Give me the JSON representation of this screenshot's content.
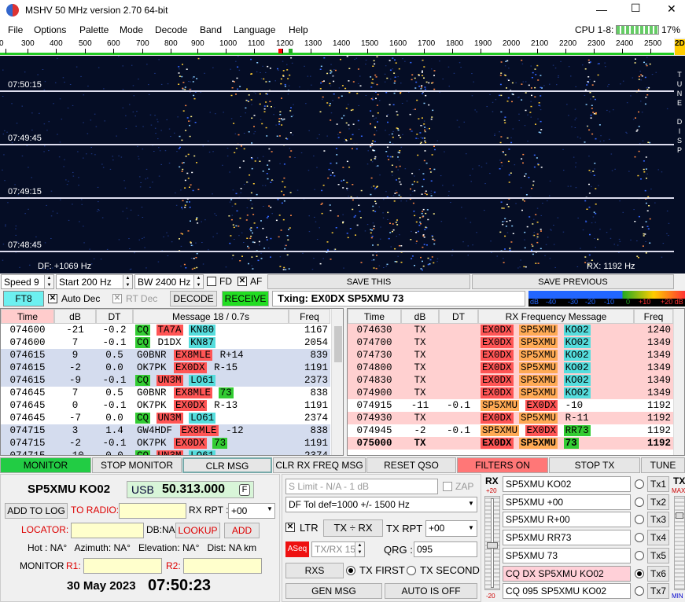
{
  "window": {
    "title": "MSHV 50 MHz version 2.70 64-bit",
    "min": "—",
    "max": "☐",
    "close": "✕"
  },
  "menu": [
    "File",
    "Options",
    "Palette",
    "Mode",
    "Decode",
    "Band",
    "Language",
    "Help"
  ],
  "cpu": {
    "label": "CPU 1-8:",
    "value": "17%"
  },
  "ruler": {
    "ticks": [
      "0",
      "300",
      "400",
      "500",
      "600",
      "700",
      "800",
      "900",
      "1000",
      "1100",
      "1200",
      "1300",
      "1400",
      "1500",
      "1600",
      "1700",
      "1800",
      "1900",
      "2000",
      "2100",
      "2200",
      "2300",
      "2400",
      "2500"
    ],
    "side": "2D"
  },
  "waterfall": {
    "times": [
      "07:50:15",
      "07:49:45",
      "07:49:15",
      "07:48:45"
    ],
    "df": "DF: +1069 Hz",
    "rx": "RX: 1192 Hz",
    "side_letters": [
      "T",
      "U",
      "N",
      "E",
      "",
      "D",
      "I",
      "S",
      "P"
    ]
  },
  "controls": {
    "speed": "Speed 9",
    "start": "Start 200 Hz",
    "bw": "BW 2400 Hz",
    "fd": "FD",
    "af": "AF",
    "save_this": "SAVE THIS",
    "save_previous": "SAVE PREVIOUS"
  },
  "mode_bar": {
    "mode": "FT8",
    "auto_dec": "Auto Dec",
    "rt_dec": "RT Dec",
    "decode": "DECODE",
    "receive": "RECEIVE",
    "txing": "Txing: EX0DX SP5XMU 73",
    "meter_labels": [
      "dB",
      "-40",
      "-30",
      "-20",
      "-10",
      "0",
      "+10",
      "+20 dB"
    ]
  },
  "left_table": {
    "headers": [
      "Time",
      "dB",
      "DT",
      "Message 18 / 0.7s",
      "Freq"
    ],
    "rows": [
      {
        "t": "074600",
        "db": "-21",
        "dt": "-0.2",
        "msg": [
          [
            "CQ",
            "g"
          ],
          [
            "TA7A",
            "r"
          ],
          [
            "KN80",
            "c"
          ]
        ],
        "f": "1167",
        "bg": "#ffffff"
      },
      {
        "t": "074600",
        "db": "7",
        "dt": "-0.1",
        "msg": [
          [
            "CQ",
            "g"
          ],
          [
            "D1DX",
            ""
          ],
          [
            "KN87",
            "c"
          ]
        ],
        "f": "2054",
        "bg": "#ffffff"
      },
      {
        "t": "074615",
        "db": "9",
        "dt": "0.5",
        "msg": [
          [
            "G0BNR",
            ""
          ],
          [
            "EX8MLE",
            "r"
          ],
          [
            "R+14",
            ""
          ]
        ],
        "f": "839",
        "bg": "#d4dcee"
      },
      {
        "t": "074615",
        "db": "-2",
        "dt": "0.0",
        "msg": [
          [
            "OK7PK",
            ""
          ],
          [
            "EX0DX",
            "r"
          ],
          [
            "R-15",
            ""
          ]
        ],
        "f": "1191",
        "bg": "#d4dcee"
      },
      {
        "t": "074615",
        "db": "-9",
        "dt": "-0.1",
        "msg": [
          [
            "CQ",
            "g"
          ],
          [
            "UN3M",
            "r"
          ],
          [
            "LO61",
            "c"
          ]
        ],
        "f": "2373",
        "bg": "#d4dcee"
      },
      {
        "t": "074645",
        "db": "7",
        "dt": "0.5",
        "msg": [
          [
            "G0BNR",
            ""
          ],
          [
            "EX8MLE",
            "r"
          ],
          [
            "73",
            "g"
          ]
        ],
        "f": "838",
        "bg": "#ffffff"
      },
      {
        "t": "074645",
        "db": "0",
        "dt": "-0.1",
        "msg": [
          [
            "OK7PK",
            ""
          ],
          [
            "EX0DX",
            "r"
          ],
          [
            "R-13",
            ""
          ]
        ],
        "f": "1191",
        "bg": "#ffffff"
      },
      {
        "t": "074645",
        "db": "-7",
        "dt": "0.0",
        "msg": [
          [
            "CQ",
            "g"
          ],
          [
            "UN3M",
            "r"
          ],
          [
            "LO61",
            "c"
          ]
        ],
        "f": "2374",
        "bg": "#ffffff"
      },
      {
        "t": "074715",
        "db": "3",
        "dt": "1.4",
        "msg": [
          [
            "GW4HDF",
            ""
          ],
          [
            "EX8MLE",
            "r"
          ],
          [
            "-12",
            ""
          ]
        ],
        "f": "838",
        "bg": "#d4dcee"
      },
      {
        "t": "074715",
        "db": "-2",
        "dt": "-0.1",
        "msg": [
          [
            "OK7PK",
            ""
          ],
          [
            "EX0DX",
            "r"
          ],
          [
            "73",
            "g"
          ]
        ],
        "f": "1191",
        "bg": "#d4dcee"
      },
      {
        "t": "074715",
        "db": "-10",
        "dt": "0.0",
        "msg": [
          [
            "CQ",
            "g"
          ],
          [
            "UN3M",
            "r"
          ],
          [
            "LO61",
            "c"
          ]
        ],
        "f": "2374",
        "bg": "#d4dcee"
      }
    ]
  },
  "right_table": {
    "headers": [
      "Time",
      "dB",
      "DT",
      "RX Frequency Message",
      "Freq"
    ],
    "rows": [
      {
        "t": "074630",
        "db": "TX",
        "dt": "",
        "msg": [
          [
            "EX0DX",
            "r"
          ],
          [
            "SP5XMU",
            "o"
          ],
          [
            "KO02",
            "c"
          ]
        ],
        "f": "1240",
        "bg": "#ffd0d0",
        "b": false
      },
      {
        "t": "074700",
        "db": "TX",
        "dt": "",
        "msg": [
          [
            "EX0DX",
            "r"
          ],
          [
            "SP5XMU",
            "o"
          ],
          [
            "KO02",
            "c"
          ]
        ],
        "f": "1349",
        "bg": "#ffd0d0",
        "b": false
      },
      {
        "t": "074730",
        "db": "TX",
        "dt": "",
        "msg": [
          [
            "EX0DX",
            "r"
          ],
          [
            "SP5XMU",
            "o"
          ],
          [
            "KO02",
            "c"
          ]
        ],
        "f": "1349",
        "bg": "#ffd0d0",
        "b": false
      },
      {
        "t": "074800",
        "db": "TX",
        "dt": "",
        "msg": [
          [
            "EX0DX",
            "r"
          ],
          [
            "SP5XMU",
            "o"
          ],
          [
            "KO02",
            "c"
          ]
        ],
        "f": "1349",
        "bg": "#ffd0d0",
        "b": false
      },
      {
        "t": "074830",
        "db": "TX",
        "dt": "",
        "msg": [
          [
            "EX0DX",
            "r"
          ],
          [
            "SP5XMU",
            "o"
          ],
          [
            "KO02",
            "c"
          ]
        ],
        "f": "1349",
        "bg": "#ffd0d0",
        "b": false
      },
      {
        "t": "074900",
        "db": "TX",
        "dt": "",
        "msg": [
          [
            "EX0DX",
            "r"
          ],
          [
            "SP5XMU",
            "o"
          ],
          [
            "KO02",
            "c"
          ]
        ],
        "f": "1349",
        "bg": "#ffd0d0",
        "b": false
      },
      {
        "t": "074915",
        "db": "-11",
        "dt": "-0.1",
        "msg": [
          [
            "SP5XMU",
            "o"
          ],
          [
            "EX0DX",
            "r"
          ],
          [
            "-10",
            ""
          ]
        ],
        "f": "1192",
        "bg": "#ffffff",
        "b": false
      },
      {
        "t": "074930",
        "db": "TX",
        "dt": "",
        "msg": [
          [
            "EX0DX",
            "r"
          ],
          [
            "SP5XMU",
            "o"
          ],
          [
            "R-11",
            ""
          ]
        ],
        "f": "1192",
        "bg": "#ffd0d0",
        "b": false
      },
      {
        "t": "074945",
        "db": "-2",
        "dt": "-0.1",
        "msg": [
          [
            "SP5XMU",
            "o"
          ],
          [
            "EX0DX",
            "r"
          ],
          [
            "RR73",
            "g"
          ]
        ],
        "f": "1192",
        "bg": "#ffffff",
        "b": false
      },
      {
        "t": "075000",
        "db": "TX",
        "dt": "",
        "msg": [
          [
            "EX0DX",
            "r"
          ],
          [
            "SP5XMU",
            "o"
          ],
          [
            "73",
            "g"
          ]
        ],
        "f": "1192",
        "bg": "#ffd0d0",
        "b": true
      }
    ]
  },
  "buttons_row": [
    "MONITOR",
    "STOP MONITOR",
    "CLR MSG",
    "CLR RX FREQ MSG",
    "RESET QSO",
    "FILTERS ON",
    "STOP TX",
    "TUNE"
  ],
  "station": {
    "call": "SP5XMU KO02",
    "mode": "USB",
    "freq": "50.313.000",
    "f_btn": "F",
    "add_log": "ADD TO LOG",
    "to_radio": "TO RADIO:",
    "rx_rpt_label": "RX RPT :",
    "rx_rpt": "+00",
    "locator": "LOCATOR:",
    "dbna": "DB:NA",
    "lookup": "LOOKUP",
    "add": "ADD",
    "info": "Hot : NA°   Azimuth: NA°   Elevation: NA°   Dist: NA km",
    "monitor": "MONITOR",
    "r1": "R1:",
    "r2": "R2:",
    "date": "30 May 2023",
    "time": "07:50:23"
  },
  "middle": {
    "slimit": "S Limit - N/A - 1  dB",
    "zap": "ZAP",
    "dftol": "DF Tol def=1000 +/-  1500  Hz",
    "ltr": "LTR",
    "txrx": "TX ÷ RX",
    "tx_rpt_label": "TX RPT :",
    "tx_rpt": "+00",
    "aseq": "ASeq",
    "txrx15": "TX/RX 15  s",
    "qrg_label": "QRG :",
    "qrg": "095",
    "rxs": "RXS",
    "tx_first": "TX FIRST",
    "tx_second": "TX SECOND",
    "gen_msg": "GEN MSG",
    "auto_off": "AUTO IS OFF"
  },
  "tx_panel": {
    "rx_label": "RX",
    "rx_top": "+20",
    "rx_bot": "-20",
    "tx_label": "TX",
    "max": "MAX",
    "min": "MIN",
    "msgs": [
      {
        "text": "SP5XMU KO02",
        "btn": "Tx1"
      },
      {
        "text": "SP5XMU +00",
        "btn": "Tx2"
      },
      {
        "text": "SP5XMU R+00",
        "btn": "Tx3"
      },
      {
        "text": "SP5XMU RR73",
        "btn": "Tx4"
      },
      {
        "text": "SP5XMU 73",
        "btn": "Tx5"
      },
      {
        "text": "CQ DX SP5XMU KO02",
        "btn": "Tx6"
      },
      {
        "text": "CQ 095 SP5XMU KO02",
        "btn": "Tx7"
      }
    ]
  },
  "colors": {
    "green": "#33cc33",
    "red": "#ff5555",
    "cyan": "#55dddd",
    "orange": "#ffaa55",
    "monitor_green": "#22cc44",
    "filters_red": "#ff7777"
  }
}
